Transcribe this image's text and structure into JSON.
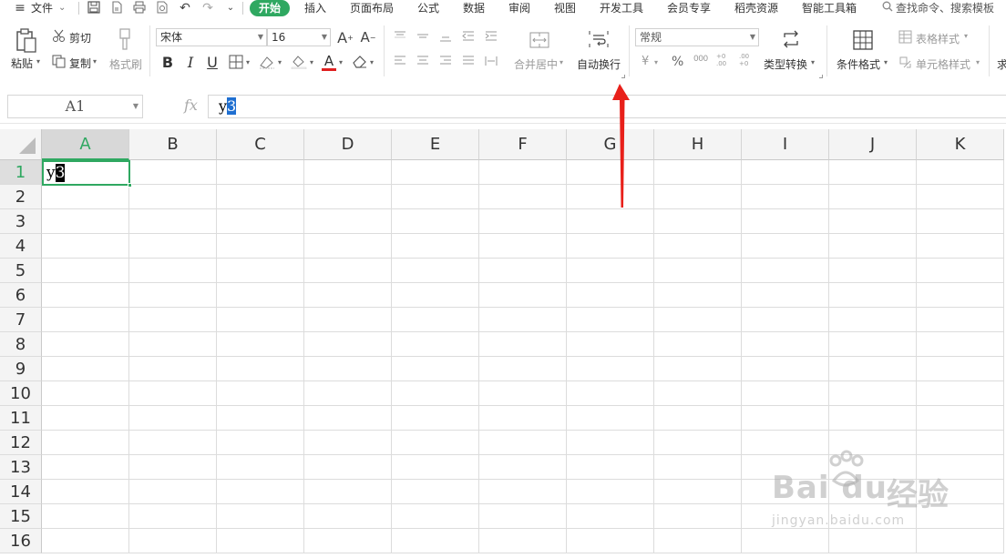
{
  "menu": {
    "file_label": "文件",
    "tabs": [
      "开始",
      "插入",
      "页面布局",
      "公式",
      "数据",
      "审阅",
      "视图",
      "开发工具",
      "会员专享",
      "稻壳资源",
      "智能工具箱"
    ],
    "active_tab": "开始",
    "search_text": "查找命令、搜索模板"
  },
  "ribbon": {
    "paste": "粘贴",
    "cut": "剪切",
    "copy": "复制",
    "format_painter": "格式刷",
    "font_name": "宋体",
    "font_size": "16",
    "bold": "B",
    "italic": "I",
    "underline": "U",
    "font_color_letter": "A",
    "merge_center": "合并居中",
    "wrap_text": "自动换行",
    "number_format": "常规",
    "currency_symbol": "¥",
    "percent_symbol": "%",
    "thousands": "000",
    "dec_increase": "+0 .00",
    "dec_decrease": ".00 +0",
    "type_convert": "类型转换",
    "conditional_format": "条件格式",
    "table_style": "表格样式",
    "cell_style": "单元格样式",
    "sum_partial": "求",
    "colors": {
      "brand_green": "#2fa861",
      "font_color_bar": "#e02020",
      "arrow_red": "#e8201a",
      "formula_selection": "#1f6fd1"
    }
  },
  "formula_bar": {
    "name_box": "A1",
    "fx_label": "fx",
    "value_plain": "y",
    "value_selected": "3"
  },
  "grid": {
    "columns": [
      "A",
      "B",
      "C",
      "D",
      "E",
      "F",
      "G",
      "H",
      "I",
      "J",
      "K"
    ],
    "rows": [
      "1",
      "2",
      "3",
      "4",
      "5",
      "6",
      "7",
      "8",
      "9",
      "10",
      "11",
      "12",
      "13",
      "14",
      "15",
      "16"
    ],
    "active_cell": {
      "ref": "A1",
      "text_plain": "y",
      "text_selected": "3"
    }
  },
  "watermark": {
    "brand": "Bai du",
    "name": "经验",
    "url": "jingyan.baidu.com"
  }
}
